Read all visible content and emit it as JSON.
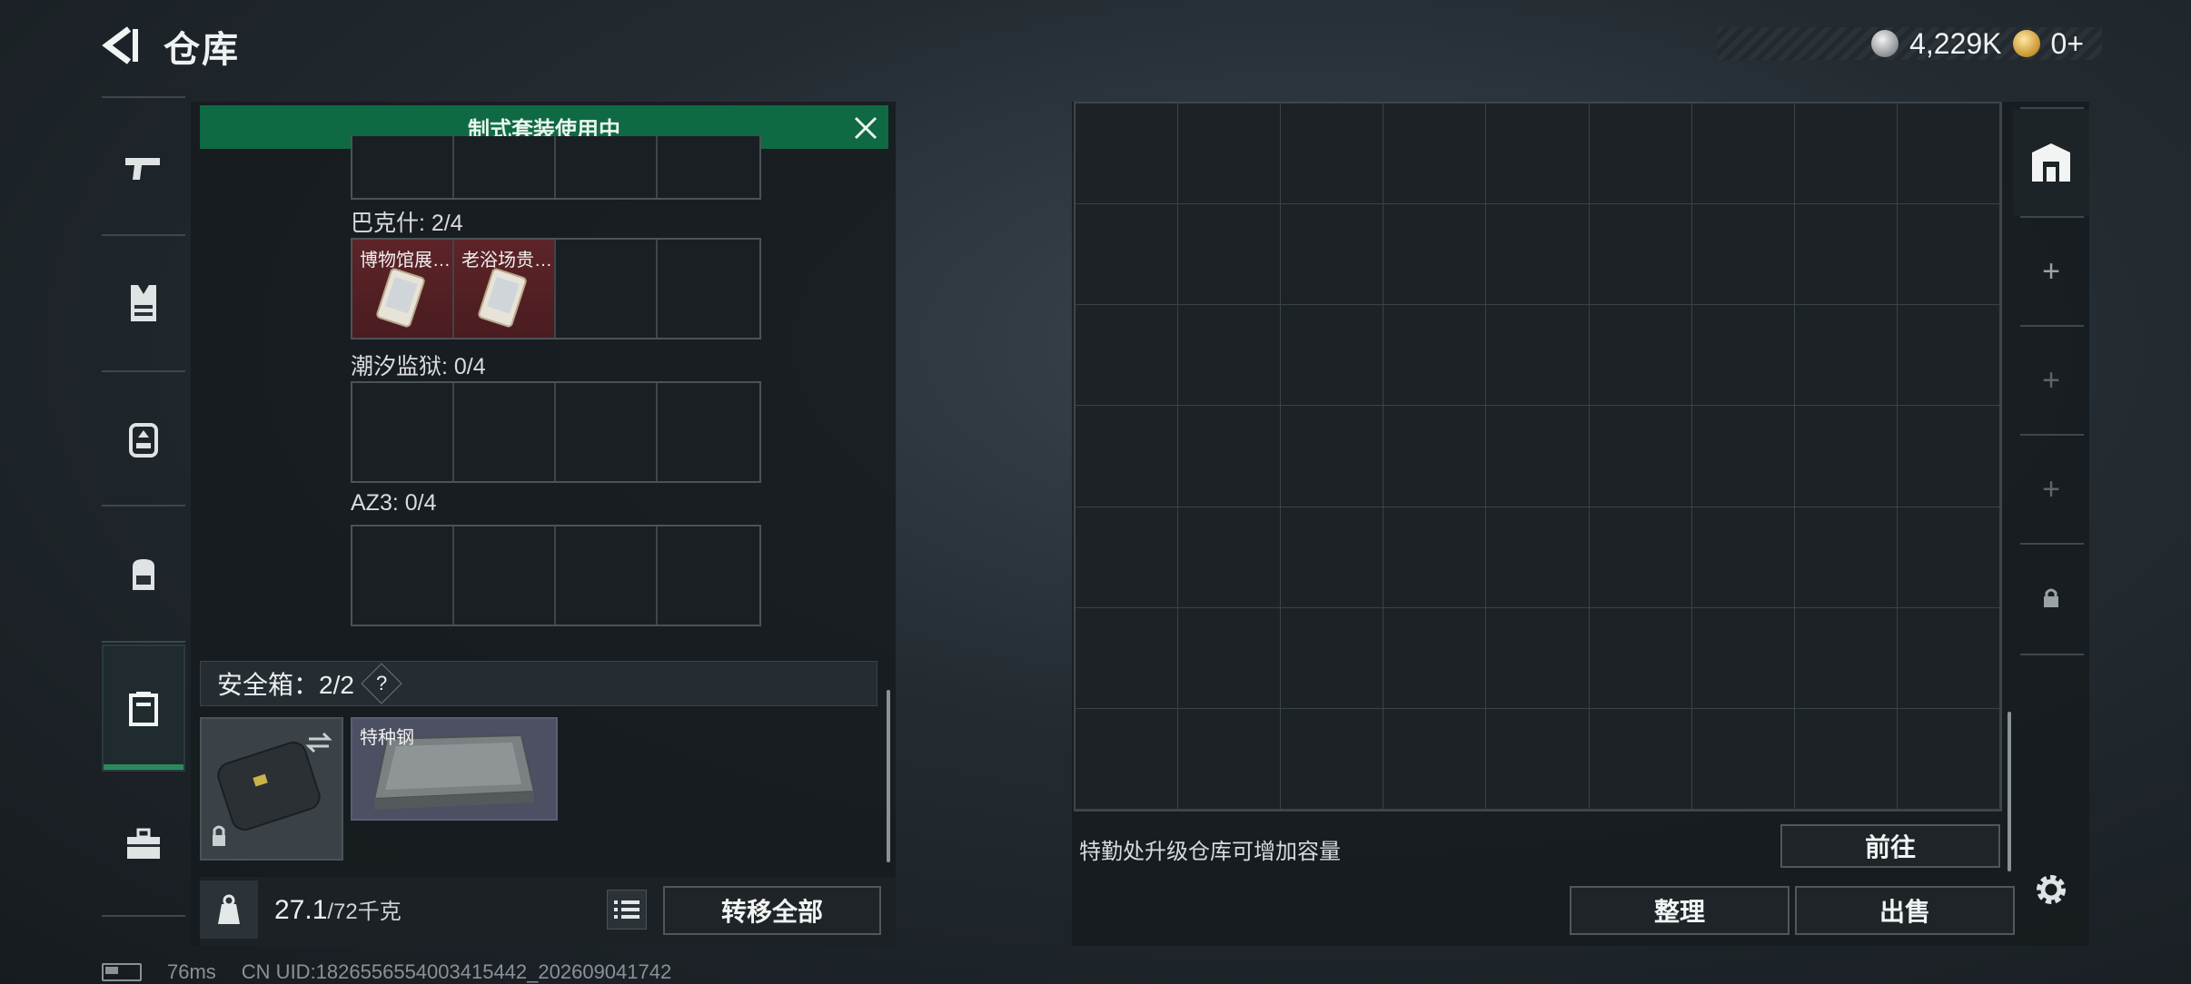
{
  "header": {
    "title": "仓库"
  },
  "currency": {
    "silver": "4,229K",
    "gold": "0+"
  },
  "left_nav": {
    "items": [
      "pistol-icon",
      "vest-icon",
      "chest-rig-icon",
      "backpack-icon",
      "safe-box-icon",
      "toolbox-icon"
    ],
    "active": "safe-box-icon"
  },
  "banner": {
    "text": "制式套装使用中"
  },
  "groups": [
    {
      "label": "巴克什: 2/4",
      "items": [
        "博物馆展…",
        "老浴场贵…"
      ]
    },
    {
      "label": "潮汐监狱: 0/4",
      "items": []
    },
    {
      "label": "AZ3: 0/4",
      "items": []
    }
  ],
  "safebox": {
    "label": "安全箱：2/2",
    "help": "?",
    "item_label": "特种钢"
  },
  "footer_left": {
    "weight_value": "27.1",
    "weight_cap": "/72千克",
    "transfer_all": "转移全部"
  },
  "right_panel": {
    "hint": "特勤处升级仓库可增加容量",
    "goto": "前往",
    "organize": "整理",
    "sell": "出售"
  },
  "statusbar": {
    "ping": "76ms",
    "uid": "CN UID:1826556554003415442_202609041742"
  },
  "colors": {
    "accent_green": "#0f6a44",
    "filled_red": "#5d2428"
  }
}
